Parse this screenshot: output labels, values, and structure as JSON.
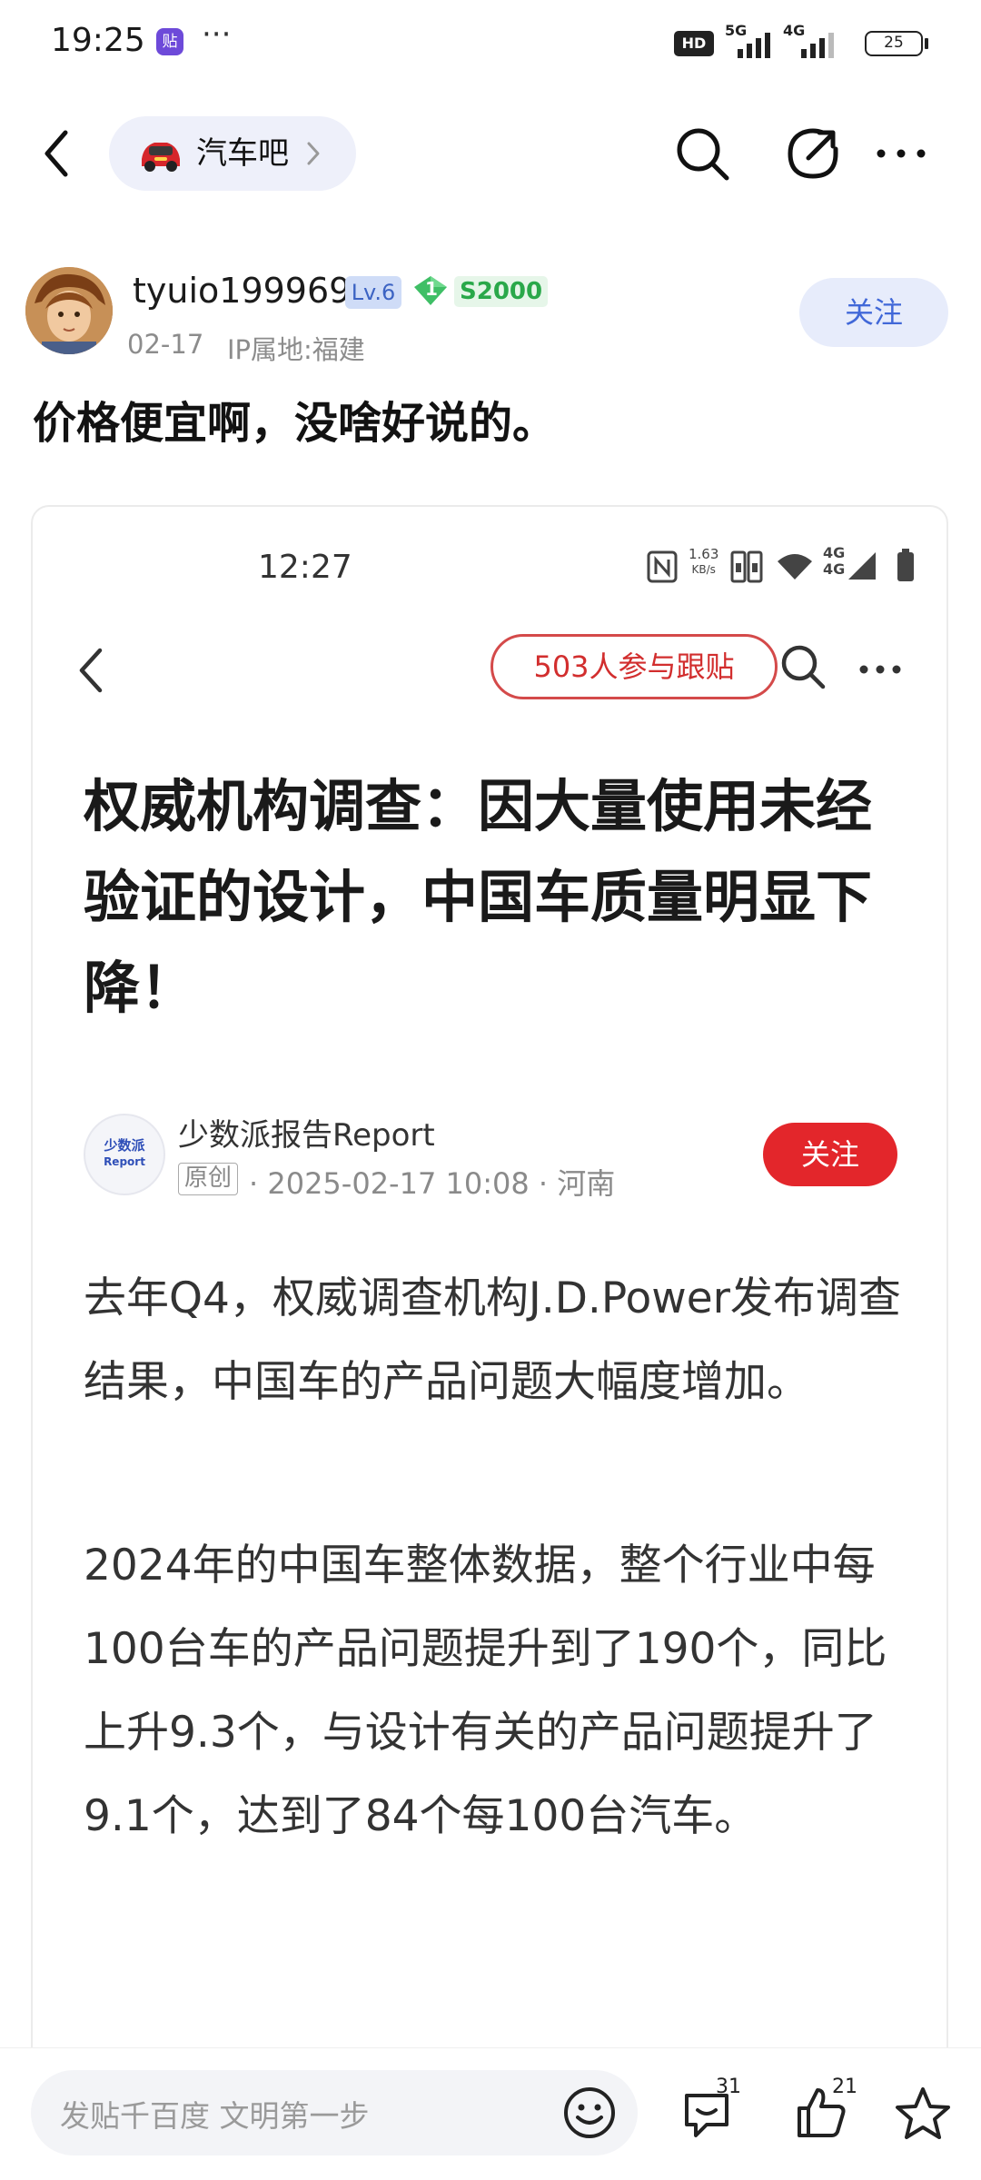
{
  "status_bar": {
    "time": "19:25",
    "app_icon_text": "贴",
    "dots": "···",
    "hd": "HD",
    "net1": "5G",
    "net2": "4G",
    "battery": "25"
  },
  "nav": {
    "forum_name": "汽车吧"
  },
  "author": {
    "username": "tyuio199969",
    "level": "Lv.6",
    "gem_level": "1",
    "gem_score": "S2000",
    "date": "02-17",
    "ip_location": "IP属地:福建",
    "follow_label": "关注"
  },
  "post": {
    "text": "价格便宜啊，没啥好说的。"
  },
  "embedded": {
    "status_time": "12:27",
    "speed_value": "1.63",
    "speed_unit": "KB/s",
    "net_a": "4G",
    "net_b": "4G",
    "participants": "503人参与跟贴",
    "headline": "权威机构调查：因大量使用未经验证的设计，中国车质量明显下降！",
    "source_name": "少数派报告Report",
    "logo_text_1": "少数派",
    "logo_text_2": "Report",
    "original_badge": "原创",
    "source_meta": "· 2025-02-17 10:08 · 河南",
    "follow_label": "关注",
    "paragraph_1": "去年Q4，权威调查机构J.D.Power发布调查结果，中国车的产品问题大幅度增加。",
    "paragraph_2": "2024年的中国车整体数据，整个行业中每100台车的产品问题提升到了190个，同比上升9.3个，与设计有关的产品问题提升了9.1个，达到了84个每100台汽车。"
  },
  "bottom_bar": {
    "reply_placeholder": "发贴千百度 文明第一步",
    "comment_count": "31",
    "like_count": "21"
  },
  "colors": {
    "accent_blue": "#4168d8",
    "red": "#e3262b",
    "gem_green": "#2aa84a"
  }
}
